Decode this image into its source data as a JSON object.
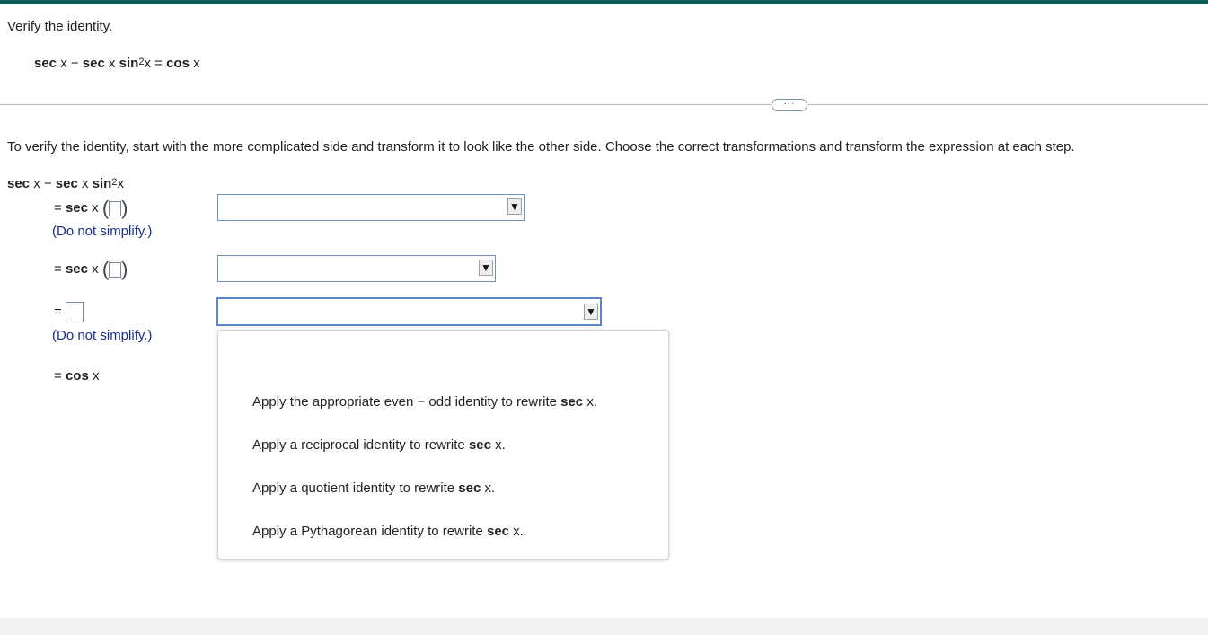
{
  "colors": {
    "topbar": "#0d5b52",
    "note_text": "#1b2e8c",
    "select_border": "#6f93c9"
  },
  "question": {
    "prompt": "Verify the identity.",
    "identity": {
      "t1": "sec",
      "t2": " x − ",
      "t3": "sec",
      "t4": " x ",
      "t5": "sin",
      "exp": "2",
      "t6": "x = ",
      "t7": "cos",
      "t8": " x"
    }
  },
  "more_button": {
    "label": "···"
  },
  "instructions": "To verify the identity, start with the more complicated side and transform it to look like the other side. Choose the correct transformations and transform the expression at each step.",
  "work": {
    "lhs": {
      "t1": "sec",
      "t2": " x − ",
      "t3": "sec",
      "t4": " x ",
      "t5": "sin",
      "exp": "2",
      "t6": "x"
    },
    "step1": {
      "eq": "= ",
      "fn": "sec",
      "var": " x",
      "note": "(Do not simplify.)"
    },
    "step2": {
      "eq": "= ",
      "fn": "sec",
      "var": " x"
    },
    "step3": {
      "eq": "= ",
      "note": "(Do not simplify.)"
    },
    "step4": {
      "eq": "= ",
      "fn": "cos",
      "var": " x"
    }
  },
  "dropdowns": [
    {
      "value": "",
      "arrow": "▼"
    },
    {
      "value": "",
      "arrow": "▼"
    },
    {
      "value": "",
      "arrow": "▼"
    }
  ],
  "menu_options": [
    {
      "text": "Apply the appropriate even − odd identity to rewrite ",
      "bold": "sec",
      "tail": " x."
    },
    {
      "text": "Apply a reciprocal identity to rewrite ",
      "bold": "sec",
      "tail": " x."
    },
    {
      "text": "Apply a quotient identity to rewrite ",
      "bold": "sec",
      "tail": " x."
    },
    {
      "text": "Apply a Pythagorean identity to rewrite ",
      "bold": "sec",
      "tail": " x."
    }
  ]
}
